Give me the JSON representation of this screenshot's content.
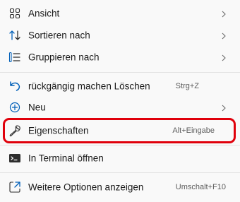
{
  "menu": {
    "items": [
      {
        "label": "Ansicht",
        "icon": "view-grid-icon",
        "submenu": true
      },
      {
        "label": "Sortieren nach",
        "icon": "sort-arrows-icon",
        "submenu": true
      },
      {
        "label": "Gruppieren nach",
        "icon": "group-list-icon",
        "submenu": true
      },
      {
        "label": "rückgängig machen Löschen",
        "icon": "undo-icon",
        "shortcut": "Strg+Z"
      },
      {
        "label": "Neu",
        "icon": "new-plus-icon",
        "submenu": true
      },
      {
        "label": "Eigenschaften",
        "icon": "wrench-icon",
        "shortcut": "Alt+Eingabe"
      },
      {
        "label": "In Terminal öffnen",
        "icon": "terminal-icon"
      },
      {
        "label": "Weitere Optionen anzeigen",
        "icon": "more-options-icon",
        "shortcut": "Umschalt+F10"
      }
    ]
  },
  "colors": {
    "accent": "#005fb8",
    "highlight_border": "#e0000b",
    "background": "#f9f9f9",
    "separator": "#e3e3e3"
  }
}
